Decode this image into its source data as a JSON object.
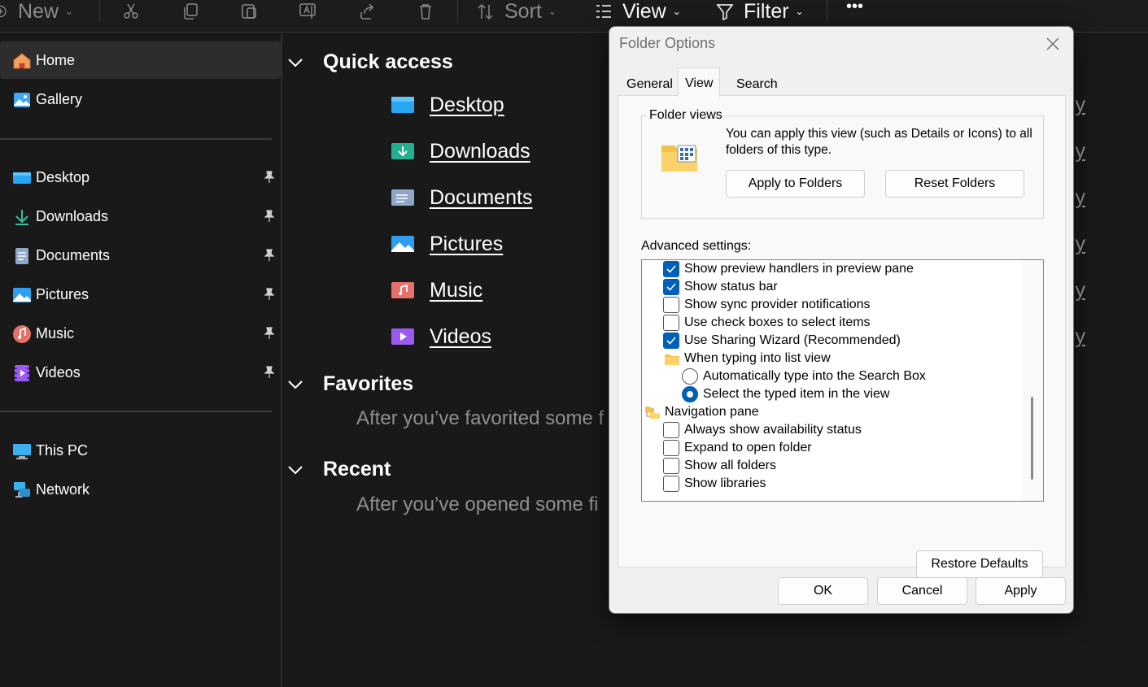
{
  "toolbar": {
    "new_label": "New",
    "sort_label": "Sort",
    "view_label": "View",
    "filter_label": "Filter",
    "more_label": "•••"
  },
  "sidebar": {
    "items": [
      {
        "label": "Home",
        "icon": "home-icon"
      },
      {
        "label": "Gallery",
        "icon": "gallery-icon"
      },
      {
        "label": "Desktop",
        "icon": "desktop-icon"
      },
      {
        "label": "Downloads",
        "icon": "downloads-icon"
      },
      {
        "label": "Documents",
        "icon": "documents-icon"
      },
      {
        "label": "Pictures",
        "icon": "pictures-icon"
      },
      {
        "label": "Music",
        "icon": "music-icon"
      },
      {
        "label": "Videos",
        "icon": "videos-icon"
      },
      {
        "label": "This PC",
        "icon": "this-pc-icon"
      },
      {
        "label": "Network",
        "icon": "network-icon"
      }
    ]
  },
  "main": {
    "quick_access": {
      "title": "Quick access",
      "items": [
        "Desktop",
        "Downloads",
        "Documents",
        "Pictures",
        "Music",
        "Videos"
      ]
    },
    "favorites": {
      "title": "Favorites",
      "hint": "After you’ve favorited some f"
    },
    "recent": {
      "title": "Recent",
      "hint": "After you’ve opened some fi"
    },
    "ghost_text": "y"
  },
  "dialog": {
    "title": "Folder Options",
    "tabs": [
      "General",
      "View",
      "Search"
    ],
    "selected_tab": "View",
    "folder_views": {
      "label": "Folder views",
      "text": "You can apply this view (such as Details or Icons) to all folders of this type.",
      "apply_button": "Apply to Folders",
      "reset_button": "Reset Folders"
    },
    "advanced_label": "Advanced settings:",
    "settings": [
      {
        "type": "checkbox",
        "label": "Show preview handlers in preview pane",
        "checked": true
      },
      {
        "type": "checkbox",
        "label": "Show status bar",
        "checked": true
      },
      {
        "type": "checkbox",
        "label": "Show sync provider notifications",
        "checked": false
      },
      {
        "type": "checkbox",
        "label": "Use check boxes to select items",
        "checked": false
      },
      {
        "type": "checkbox",
        "label": "Use Sharing Wizard (Recommended)",
        "checked": true
      },
      {
        "type": "folder",
        "label": "When typing into list view"
      },
      {
        "type": "radio",
        "label": "Automatically type into the Search Box",
        "checked": false
      },
      {
        "type": "radio",
        "label": "Select the typed item in the view",
        "checked": true
      },
      {
        "type": "folder",
        "label": "Navigation pane"
      },
      {
        "type": "checkbox",
        "label": "Always show availability status",
        "checked": false
      },
      {
        "type": "checkbox",
        "label": "Expand to open folder",
        "checked": false
      },
      {
        "type": "checkbox",
        "label": "Show all folders",
        "checked": false
      },
      {
        "type": "checkbox",
        "label": "Show libraries",
        "checked": false
      }
    ],
    "restore_button": "Restore Defaults",
    "ok_button": "OK",
    "cancel_button": "Cancel",
    "apply_button": "Apply"
  },
  "colors": {
    "accent": "#005fb8",
    "background": "#191919",
    "dialog_bg": "#f0f0f0"
  }
}
